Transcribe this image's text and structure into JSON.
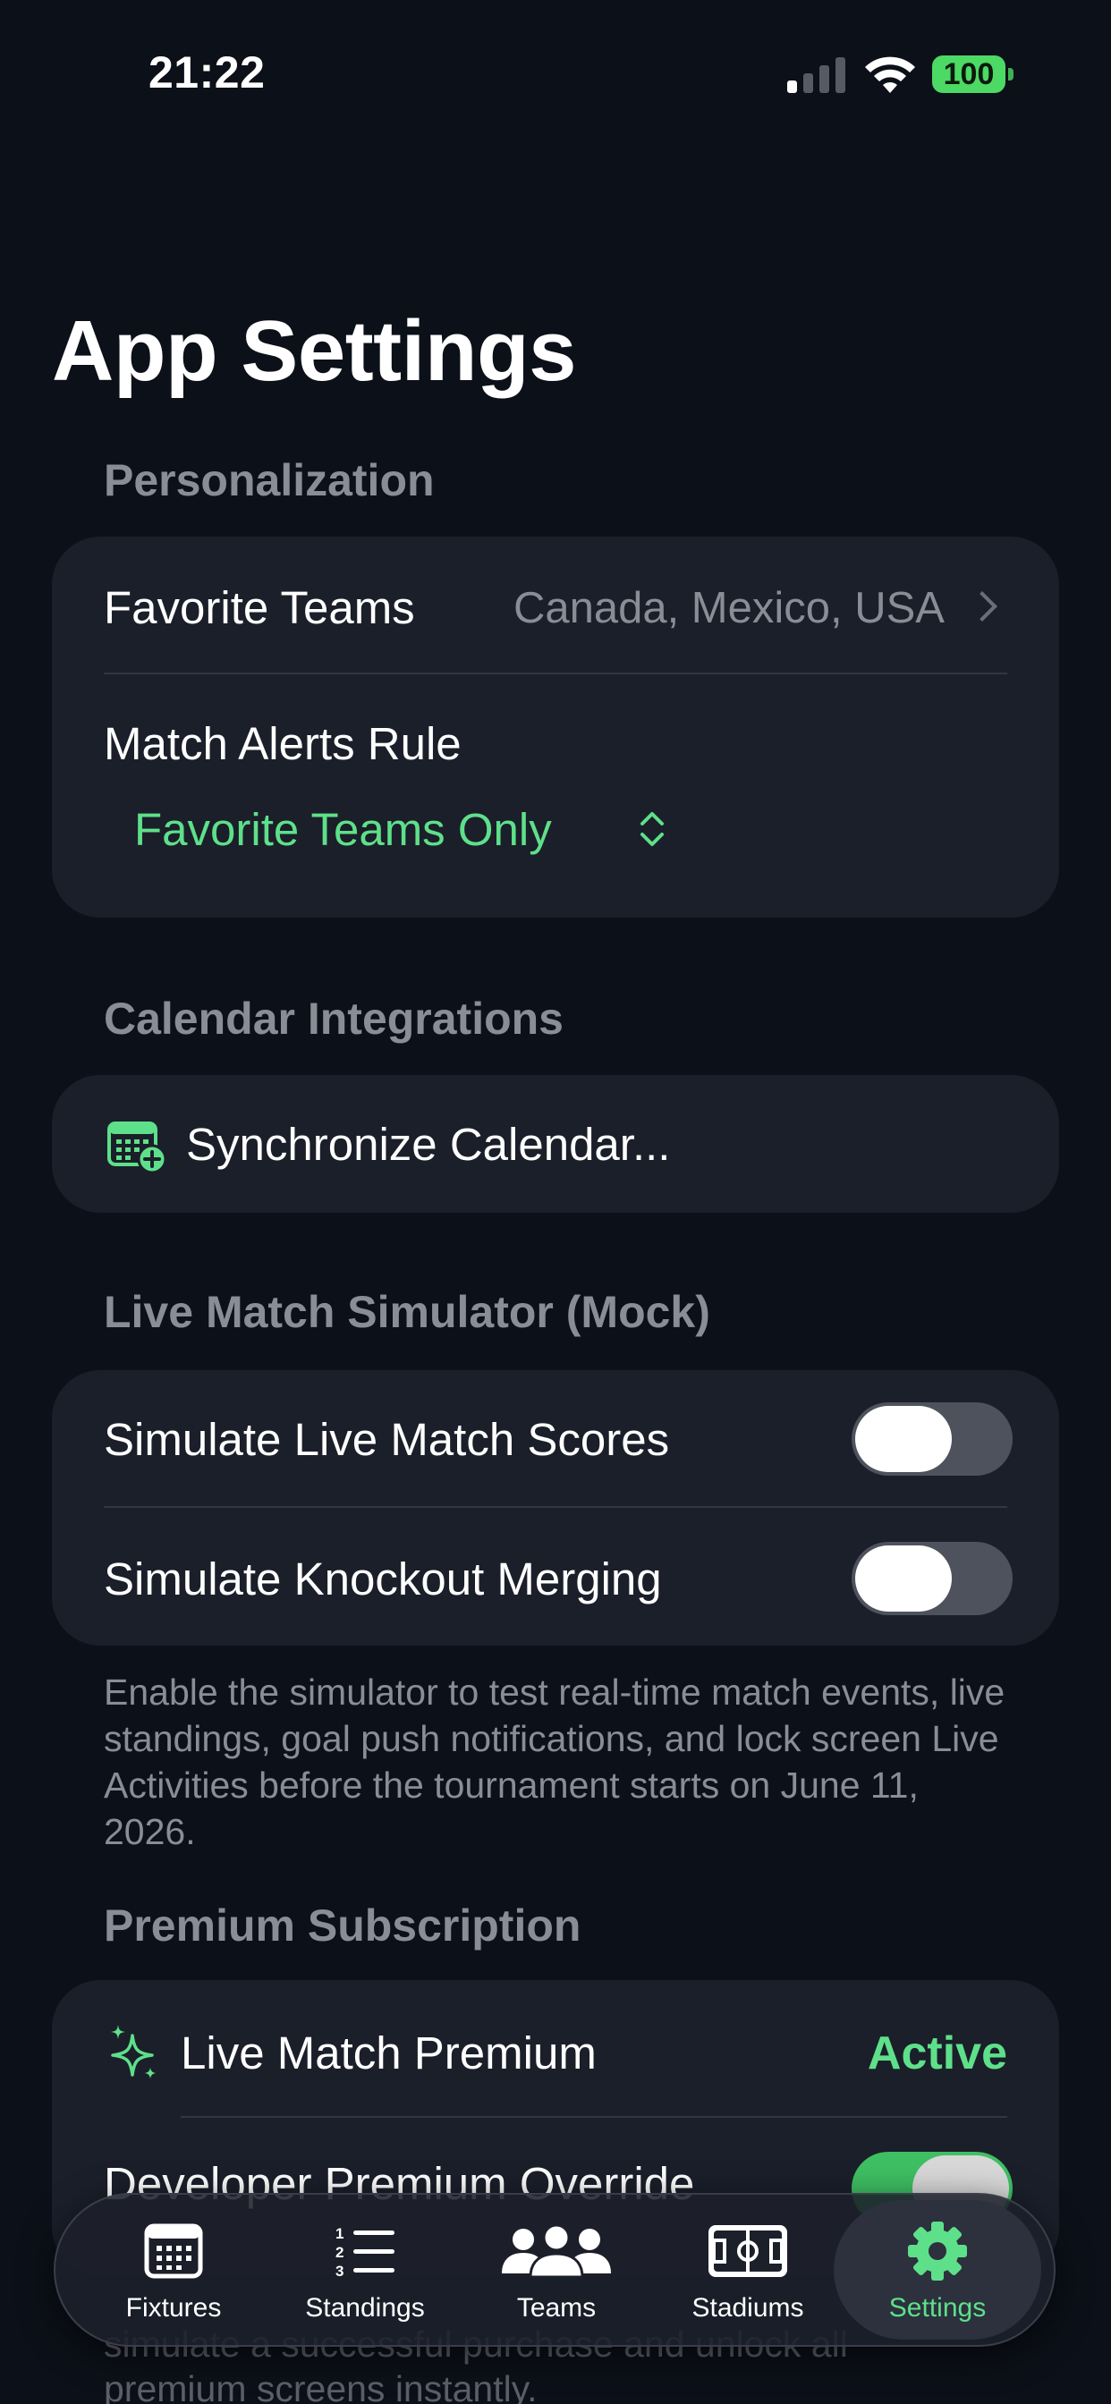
{
  "status_bar": {
    "time": "21:22",
    "battery": "100"
  },
  "page_title": "App Settings",
  "personalization": {
    "header": "Personalization",
    "favorite_teams_label": "Favorite Teams",
    "favorite_teams_value": "Canada, Mexico, USA",
    "match_alerts_label": "Match Alerts Rule",
    "match_alerts_value": "Favorite Teams Only"
  },
  "calendar": {
    "header": "Calendar Integrations",
    "sync_label": "Synchronize Calendar..."
  },
  "simulator": {
    "header": "Live Match Simulator (Mock)",
    "live_scores_label": "Simulate Live Match Scores",
    "live_scores_on": false,
    "knockout_label": "Simulate Knockout Merging",
    "knockout_on": false,
    "footnote": "Enable the simulator to test real-time match events, live standings, goal push notifications, and lock screen Live Activities before the tournament starts on June 11, 2026."
  },
  "premium": {
    "header": "Premium Subscription",
    "live_premium_label": "Live Match Premium",
    "live_premium_status": "Active",
    "developer_override_label": "Developer Premium Override",
    "developer_override_on": true,
    "footnote_partial_1": "simulate a successful purchase and unlock all",
    "footnote_partial_2": "premium screens instantly."
  },
  "tab_bar": {
    "tabs": [
      {
        "label": "Fixtures",
        "icon": "calendar-grid-icon"
      },
      {
        "label": "Standings",
        "icon": "numbered-list-icon"
      },
      {
        "label": "Teams",
        "icon": "people-icon"
      },
      {
        "label": "Stadiums",
        "icon": "soccer-field-icon"
      },
      {
        "label": "Settings",
        "icon": "gear-icon"
      }
    ],
    "selected_index": 4
  },
  "colors": {
    "accent": "#5ee08a",
    "background": "#0c1018",
    "card": "#1b1f2a",
    "secondary_text": "#8a8d95"
  }
}
